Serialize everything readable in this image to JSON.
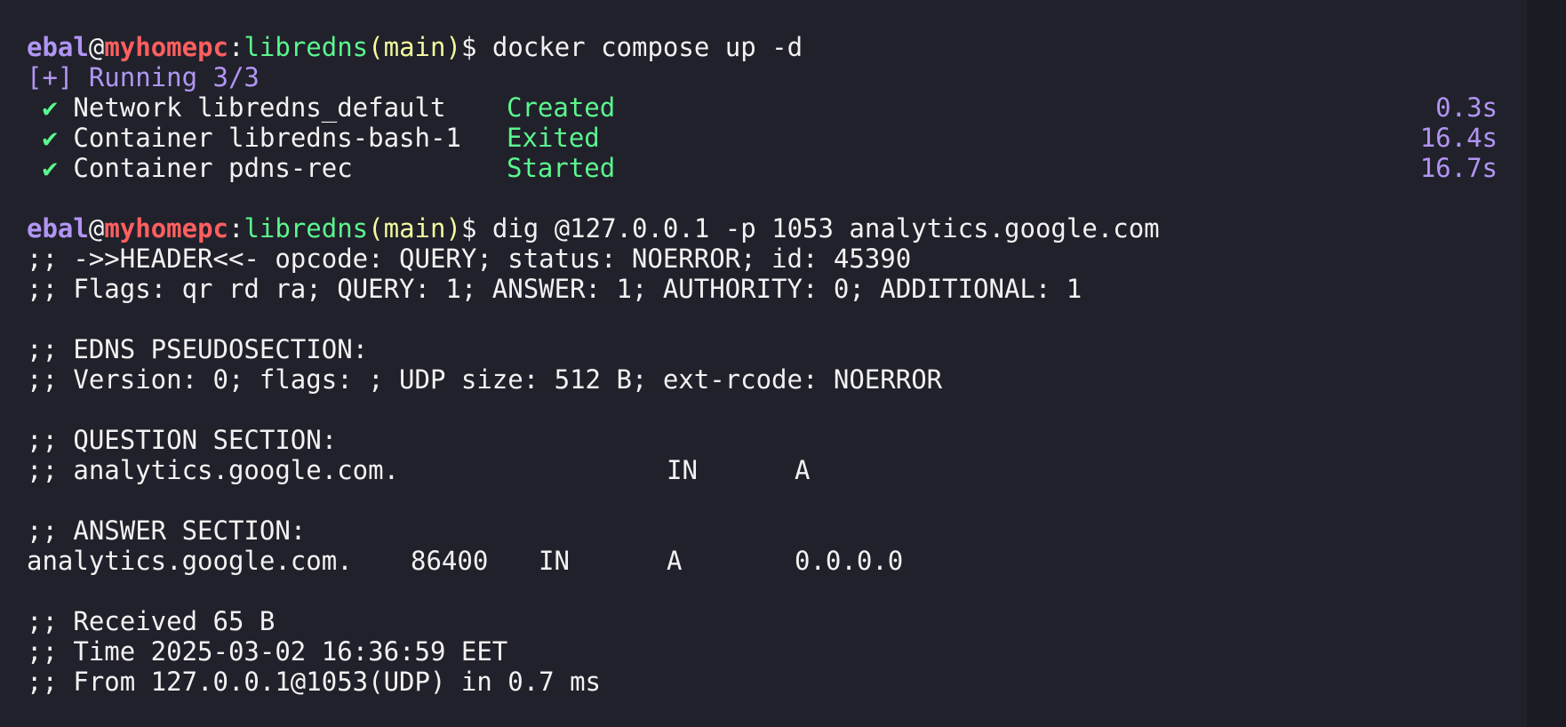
{
  "prompt": {
    "user": "ebal",
    "at": "@",
    "host": "myhomepc",
    "colon": ":",
    "path": "libredns",
    "paren_open": "(",
    "branch": "main",
    "paren_close": ")",
    "dollar": "$ "
  },
  "commands": [
    "docker compose up -d",
    "dig @127.0.0.1 -p 1053 analytics.google.com"
  ],
  "compose": {
    "running": "[+] Running 3/3",
    "check_icon": "✔",
    "items": [
      {
        "name": "Network libredns_default",
        "status": "Created",
        "time": "0.3s"
      },
      {
        "name": "Container libredns-bash-1",
        "status": "Exited",
        "time": "16.4s"
      },
      {
        "name": "Container pdns-rec",
        "status": "Started",
        "time": "16.7s"
      }
    ]
  },
  "dig": {
    "header": ";; ->>HEADER<<- opcode: QUERY; status: NOERROR; id: 45390",
    "flags": ";; Flags: qr rd ra; QUERY: 1; ANSWER: 1; AUTHORITY: 0; ADDITIONAL: 1",
    "edns_title": ";; EDNS PSEUDOSECTION:",
    "edns_line": ";; Version: 0; flags: ; UDP size: 512 B; ext-rcode: NOERROR",
    "question_title": ";; QUESTION SECTION:",
    "question": {
      "name": ";; analytics.google.com.",
      "class": "IN",
      "type": "A"
    },
    "answer_title": ";; ANSWER SECTION:",
    "answer": {
      "name": "analytics.google.com.",
      "ttl": "86400",
      "class": "IN",
      "type": "A",
      "address": "0.0.0.0"
    },
    "received": ";; Received 65 B",
    "time": ";; Time 2025-03-02 16:36:59 EET",
    "from": ";; From 127.0.0.1@1053(UDP) in 0.7 ms"
  },
  "colors": {
    "background": "#21212b",
    "user": "#b195f4",
    "host": "#ff5f5f",
    "path": "#5af78e",
    "branch": "#f4f99d",
    "status": "#5af78e",
    "timing": "#b195f4",
    "text": "#f2f2f2"
  }
}
